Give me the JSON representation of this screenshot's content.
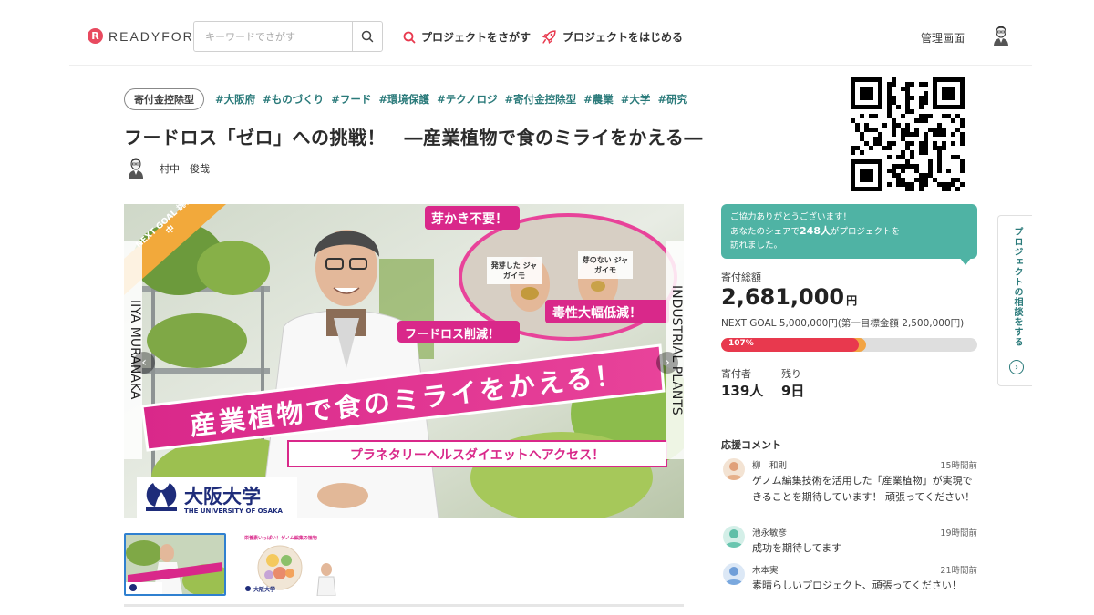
{
  "header": {
    "logo_text": "READYFOR",
    "logo_mark": "R",
    "search_placeholder": "キーワードでさがす",
    "nav_search": "プロジェクトをさがす",
    "nav_start": "プロジェクトをはじめる",
    "admin": "管理画面"
  },
  "project": {
    "tag_pill": "寄付金控除型",
    "tags": [
      "#大阪府",
      "#ものづくり",
      "#フード",
      "#環境保護",
      "#テクノロジ",
      "#寄付金控除型",
      "#農業",
      "#大学",
      "#研究"
    ],
    "title": "フードロス「ゼロ」への挑戦！　―産業植物で食のミライをかえる―",
    "owner": "村中　俊哉"
  },
  "hero": {
    "badge": "NEXT GOAL 挑戦中",
    "label_1": "芽かき不要！",
    "label_2": "毒性大幅低減！",
    "label_3": "フードロス削減！",
    "headline": "産業植物で食のミライをかえる！",
    "subline": "プラネタリーヘルスダイエットへアクセス！",
    "left_vertical": "IIYA MURANAKA",
    "right_vertical": "INDUSTRIAL PLANTS",
    "potato_1": "発芽した ジャガイモ",
    "potato_2": "芽のない ジャガイモ",
    "university": "大阪大学",
    "university_en": "THE UNIVERSITY OF OSAKA",
    "prev": "‹",
    "next": "›"
  },
  "thumbs": {
    "thumb2_title": "栄養素いっぱい！ゲノム編集の植物",
    "thumb_univ": "大阪大学"
  },
  "funding": {
    "bubble_line1": "ご協力ありがとうございます！",
    "bubble_line2_pre": "あなたのシェアで",
    "bubble_count": "248人",
    "bubble_line2_post": "がプロジェクトを",
    "bubble_line3": "訪れました。",
    "total_label": "寄付総額",
    "total_amount": "2,681,000",
    "total_unit": "円",
    "next_goal": "NEXT GOAL 5,000,000円(第一目標金額 2,500,000円)",
    "progress_label": "107%",
    "progress_fraction": 0.536,
    "supporters_label": "寄付者",
    "supporters_value": "139人",
    "remaining_label": "残り",
    "remaining_value": "9日"
  },
  "comments": {
    "title": "応援コメント",
    "items": [
      {
        "name": "柳　和則",
        "time": "15時間前",
        "text": "ゲノム編集技術を活用した「産業植物」が実現できることを期待しています！ 頑張ってください！"
      },
      {
        "name": "池永敏彦",
        "time": "19時間前",
        "text": "成功を期待してます"
      },
      {
        "name": "木本実",
        "time": "21時間前",
        "text": "素晴らしいプロジェクト、頑張ってください！"
      }
    ]
  },
  "side_tab": {
    "label": "プロジェクトの相談をする",
    "icon": "›"
  },
  "colors": {
    "accent": "#e8394e",
    "teal": "#4fb3a4",
    "tag": "#2a7a7a",
    "next_goal": "#f2a444",
    "magenta": "#d9288a"
  }
}
